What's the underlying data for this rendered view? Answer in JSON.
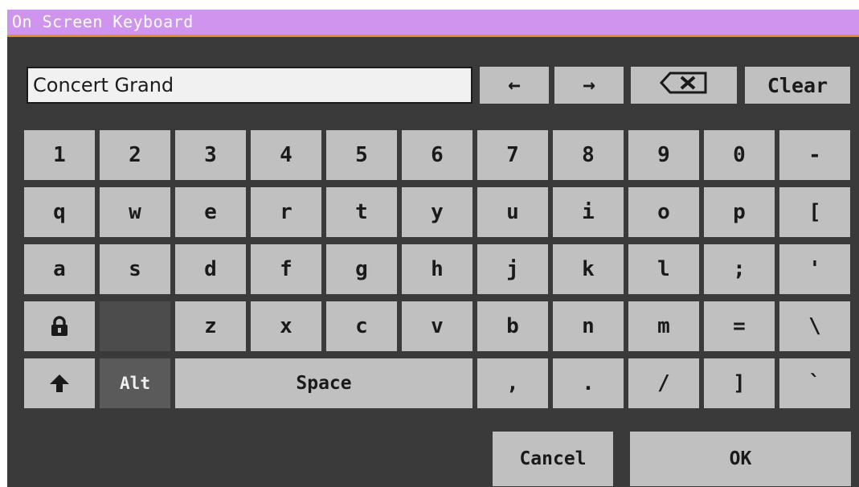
{
  "window": {
    "title": "On Screen Keyboard"
  },
  "input": {
    "value": "Concert Grand"
  },
  "toolbar": {
    "left_arrow": "←",
    "right_arrow": "→",
    "clear_label": "Clear"
  },
  "rows": {
    "numbers": [
      "1",
      "2",
      "3",
      "4",
      "5",
      "6",
      "7",
      "8",
      "9",
      "0",
      "-"
    ],
    "qwerty": [
      "q",
      "w",
      "e",
      "r",
      "t",
      "y",
      "u",
      "i",
      "o",
      "p",
      "["
    ],
    "asdf": [
      "a",
      "s",
      "d",
      "f",
      "g",
      "h",
      "j",
      "k",
      "l",
      ";",
      "'"
    ],
    "zxcv": [
      "z",
      "x",
      "c",
      "v",
      "b",
      "n",
      "m",
      "=",
      "\\"
    ],
    "bottom": [
      "Alt",
      "Space",
      ",",
      ".",
      "/",
      "]",
      "`"
    ]
  },
  "footer": {
    "cancel_label": "Cancel",
    "ok_label": "OK"
  },
  "colors": {
    "title_bar": "#cf95ee",
    "title_accent": "#e88d2a",
    "background": "#3a3a3a",
    "key": "#c0c0c0",
    "key_active": "#5a5a5a"
  },
  "icons": {
    "lock": "lock-icon",
    "shift": "shift-arrow-icon",
    "backspace": "backspace-icon"
  }
}
